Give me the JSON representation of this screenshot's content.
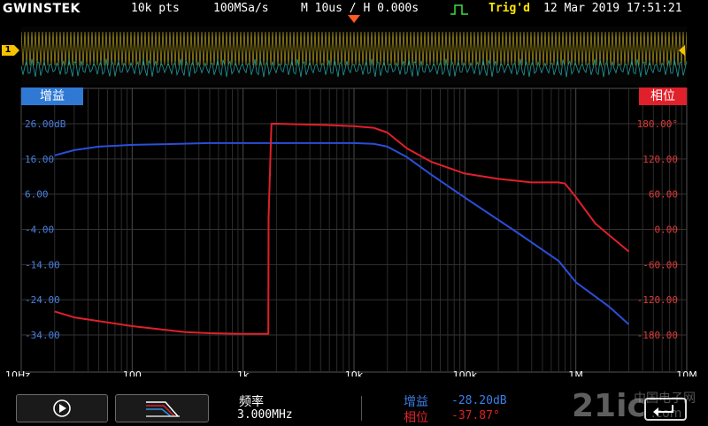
{
  "topbar": {
    "brand": "GWINSTEK",
    "record_length": "10k pts",
    "sample_rate": "100MSa/s",
    "timebase": "M 10us / H 0.000s",
    "trigger_status": "Trig'd",
    "datetime": "12 Mar 2019 17:51:21"
  },
  "channel_marker": "1",
  "gain_tag": "增益",
  "phase_tag": "相位",
  "bottom": {
    "freq_label": "频率",
    "freq_value": "3.000MHz",
    "gain_label": "增益",
    "gain_value": "-28.20dB",
    "phase_label": "相位",
    "phase_value": "-37.87°"
  },
  "watermark": {
    "text": "21ic",
    "sub": "中国电子网",
    "domain": ".com"
  },
  "colors": {
    "gain": "#2a4fd8",
    "phase": "#e0202a",
    "channel1": "#c9b21a",
    "channel2": "#1e9b9b",
    "grid": "#3a3a3a"
  },
  "chart_data": {
    "type": "line",
    "x_scale": "log",
    "x_ticks": [
      "10Hz",
      "100",
      "1k",
      "10k",
      "100k",
      "1M",
      "10M"
    ],
    "x_tick_values": [
      10,
      100,
      1000,
      10000,
      100000,
      1000000,
      10000000
    ],
    "xlim": [
      10,
      10000000
    ],
    "y_left_ticks": [
      "26.00dB",
      "16.00",
      "6.00",
      "-4.00",
      "-14.00",
      "-24.00",
      "-34.00"
    ],
    "y_left_lim": [
      -34,
      26
    ],
    "y_right_ticks": [
      "180.00°",
      "120.00",
      "60.00",
      "0.00",
      "-60.00",
      "-120.00",
      "-180.00"
    ],
    "y_right_lim": [
      -180,
      180
    ],
    "grid": true,
    "series": [
      {
        "name": "增益",
        "axis": "left",
        "x": [
          20,
          30,
          50,
          100,
          200,
          500,
          1000,
          3000,
          10000,
          15000,
          20000,
          30000,
          50000,
          100000,
          300000,
          700000,
          1000000,
          2000000,
          3000000
        ],
        "y": [
          17,
          18.5,
          19.5,
          20,
          20.2,
          20.5,
          20.5,
          20.5,
          20.5,
          20.3,
          19.5,
          16.5,
          11.5,
          5,
          -5,
          -13,
          -19,
          -26,
          -31
        ]
      },
      {
        "name": "相位",
        "axis": "right",
        "x": [
          20,
          30,
          100,
          300,
          500,
          1000,
          1690,
          1700,
          1800,
          2000,
          5000,
          10000,
          15000,
          20000,
          30000,
          50000,
          100000,
          200000,
          400000,
          700000,
          800000,
          1000000,
          1500000,
          2000000,
          3000000
        ],
        "y": [
          -140,
          -150,
          -165,
          -175,
          -177,
          -178,
          -178,
          20,
          180,
          180,
          178,
          176,
          173,
          165,
          138,
          115,
          95,
          86,
          80,
          80,
          78,
          55,
          10,
          -10,
          -37.87
        ]
      }
    ]
  }
}
